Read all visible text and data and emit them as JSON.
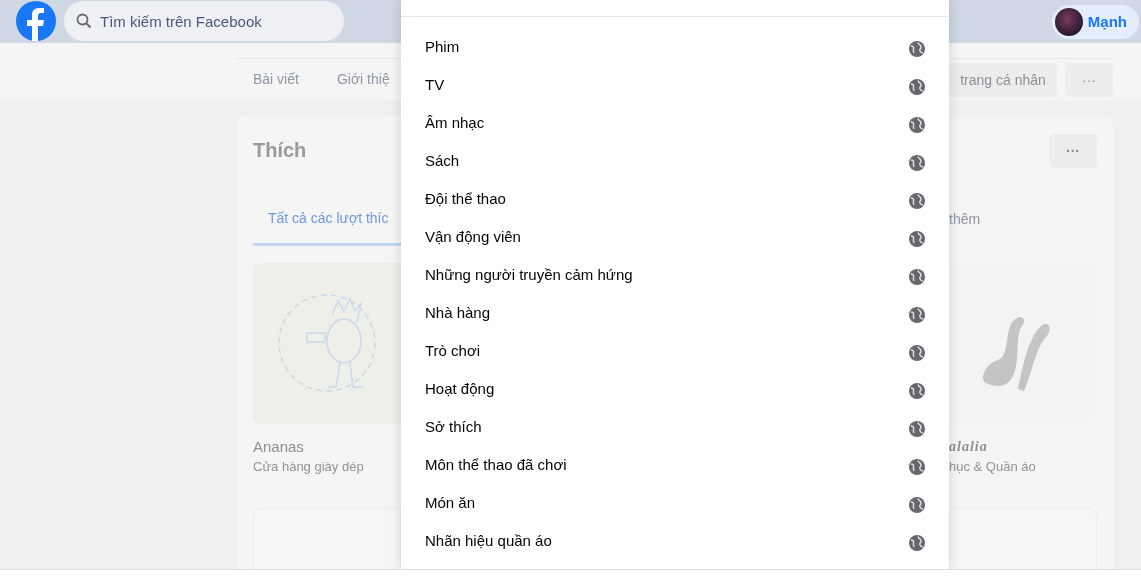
{
  "header": {
    "search": {
      "placeholder": "Tìm kiếm trên Facebook"
    },
    "profile": {
      "name": "Mạnh"
    }
  },
  "profile_tabs": [
    {
      "label": "Bài viết",
      "selected": false
    },
    {
      "label": "Giới thiệ",
      "selected": false
    }
  ],
  "profile_actions": {
    "edit_button": "trang cá nhân",
    "more_button": "···"
  },
  "likes": {
    "title": "Thích",
    "more_button": "···",
    "tabs": [
      {
        "label": "Tất cả các lượt thíc",
        "selected": true
      },
      {
        "label": "thêm",
        "selected": false
      }
    ],
    "pages": [
      {
        "name": "Ananas",
        "category": "Cửa hàng giày dép",
        "kind": "picture"
      },
      {
        "name": "alalia",
        "category": "hục & Quần áo",
        "kind": "picture"
      }
    ]
  },
  "dialog": {
    "categories": [
      {
        "label": "Phim"
      },
      {
        "label": "TV"
      },
      {
        "label": "Âm nhạc"
      },
      {
        "label": "Sách"
      },
      {
        "label": "Đội thể thao"
      },
      {
        "label": "Vận động viên"
      },
      {
        "label": "Những người truyền cảm hứng"
      },
      {
        "label": "Nhà hàng"
      },
      {
        "label": "Trò chơi"
      },
      {
        "label": "Hoạt động"
      },
      {
        "label": "Sở thích"
      },
      {
        "label": "Môn thể thao đã chơi"
      },
      {
        "label": "Món ăn"
      },
      {
        "label": "Nhãn hiệu quần áo"
      }
    ]
  }
}
